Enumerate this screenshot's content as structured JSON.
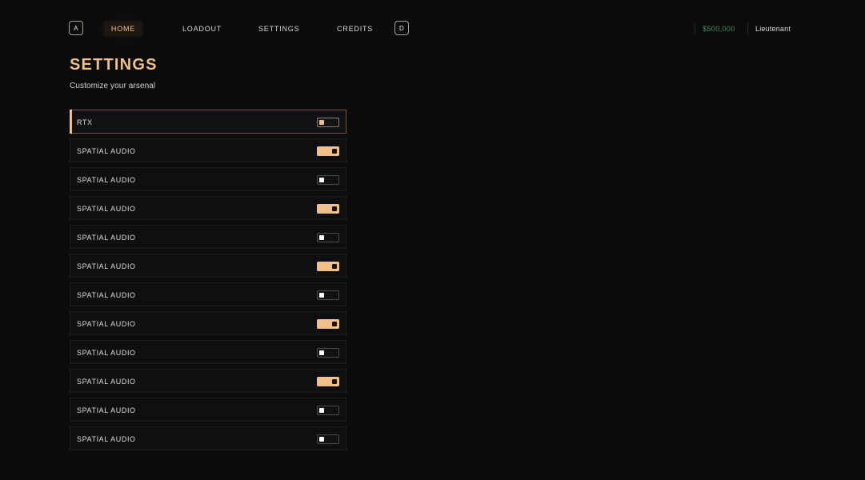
{
  "nav": {
    "left_key": "A",
    "right_key": "D",
    "tabs": [
      {
        "label": "HOME",
        "active": true
      },
      {
        "label": "LOADOUT",
        "active": false
      },
      {
        "label": "SETTINGS",
        "active": false
      },
      {
        "label": "CREDITS",
        "active": false
      }
    ]
  },
  "status": {
    "currency": "$500,000",
    "rank": "Lieutenant"
  },
  "header": {
    "title": "SETTINGS",
    "subtitle": "Customize your arsenal"
  },
  "settings": [
    {
      "label": "RTX",
      "enabled": false,
      "focused": true
    },
    {
      "label": "SPATIAL AUDIO",
      "enabled": true,
      "focused": false
    },
    {
      "label": "SPATIAL AUDIO",
      "enabled": false,
      "focused": false
    },
    {
      "label": "SPATIAL AUDIO",
      "enabled": true,
      "focused": false
    },
    {
      "label": "SPATIAL AUDIO",
      "enabled": false,
      "focused": false
    },
    {
      "label": "SPATIAL AUDIO",
      "enabled": true,
      "focused": false
    },
    {
      "label": "SPATIAL AUDIO",
      "enabled": false,
      "focused": false
    },
    {
      "label": "SPATIAL AUDIO",
      "enabled": true,
      "focused": false
    },
    {
      "label": "SPATIAL AUDIO",
      "enabled": false,
      "focused": false
    },
    {
      "label": "SPATIAL AUDIO",
      "enabled": true,
      "focused": false
    },
    {
      "label": "SPATIAL AUDIO",
      "enabled": false,
      "focused": false
    },
    {
      "label": "SPATIAL AUDIO",
      "enabled": false,
      "focused": false
    }
  ],
  "colors": {
    "background": "#0b0b0c",
    "accent": "#f0c08b",
    "currency": "#3c8f55",
    "text": "#dedede"
  }
}
